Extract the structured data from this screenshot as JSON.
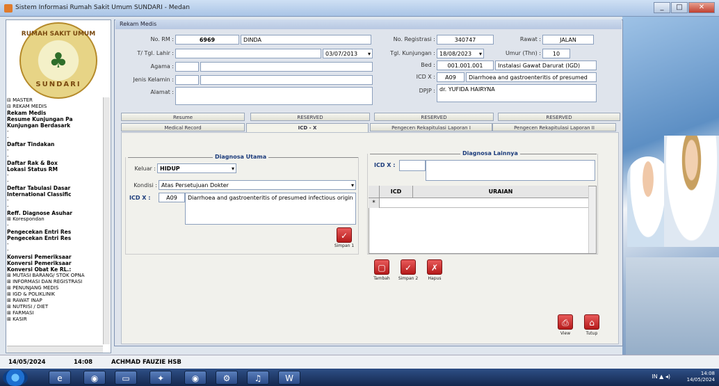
{
  "window": {
    "title": "Sistem Informasi Rumah Sakit Umum SUNDARI - Medan",
    "controls": [
      "_",
      "□",
      "✕"
    ]
  },
  "logo": {
    "top": "RUMAH SAKIT UMUM",
    "bottom": "SUNDARI"
  },
  "tree": [
    {
      "t": "⊟ MASTER",
      "c": ""
    },
    {
      "t": "⊟ REKAM MEDIS",
      "c": ""
    },
    {
      "t": "  Rekam Medis",
      "c": "b"
    },
    {
      "t": "  Resume Kunjungan Pa",
      "c": "b"
    },
    {
      "t": "  Kunjungan Berdasark",
      "c": "b"
    },
    {
      "t": "  -",
      "c": ""
    },
    {
      "t": "  -",
      "c": ""
    },
    {
      "t": "  Daftar Tindakan",
      "c": "b"
    },
    {
      "t": "  -",
      "c": ""
    },
    {
      "t": "  -",
      "c": ""
    },
    {
      "t": "  Daftar Rak & Box",
      "c": "b"
    },
    {
      "t": "  Lokasi Status RM",
      "c": "b"
    },
    {
      "t": "  -",
      "c": ""
    },
    {
      "t": "  -",
      "c": ""
    },
    {
      "t": "  Deftar Tabulasi Dasar",
      "c": "b"
    },
    {
      "t": "  International Classific",
      "c": "b"
    },
    {
      "t": "  -",
      "c": ""
    },
    {
      "t": "  -",
      "c": ""
    },
    {
      "t": "  Reff. Diagnose Asuhar",
      "c": "b"
    },
    {
      "t": " ⊞ Korespondan",
      "c": ""
    },
    {
      "t": "  -",
      "c": ""
    },
    {
      "t": "  Pengecekan Entri Res",
      "c": "b"
    },
    {
      "t": "  Pengecekan Entri Res",
      "c": "b"
    },
    {
      "t": "  -",
      "c": ""
    },
    {
      "t": "  -",
      "c": ""
    },
    {
      "t": "  Konversi Pemeriksaar",
      "c": "b"
    },
    {
      "t": "  Konversi Pemeriksaar",
      "c": "b"
    },
    {
      "t": "  Konversi Obat Ke RL.:",
      "c": "b"
    },
    {
      "t": "⊞ MUTASI BARANG/ STOK OPNA",
      "c": ""
    },
    {
      "t": "⊞ INFORMASI DAN REGISTRASI",
      "c": ""
    },
    {
      "t": "⊞ PENUNJANG MEDIS",
      "c": ""
    },
    {
      "t": "⊞ IGD & POLIKLINIK",
      "c": ""
    },
    {
      "t": "⊞ RAWAT INAP",
      "c": ""
    },
    {
      "t": "⊞ NUTRISI / DIET",
      "c": ""
    },
    {
      "t": "⊞ FARMASI",
      "c": ""
    },
    {
      "t": "⊞ KASIR",
      "c": ""
    }
  ],
  "form": {
    "header": "Rekam Medis",
    "no_rm_label": "No. RM :",
    "no_rm": "6969",
    "nama": "DINDA",
    "tgl_lahir_label": "T/ Tgl. Lahir :",
    "tgl_lahir": "03/07/2013",
    "agama_label": "Agama :",
    "jk_label": "Jenis Kelamin :",
    "alamat_label": "Alamat :",
    "no_reg_label": "No. Registrasi :",
    "no_reg": "340747",
    "rawat_label": "Rawat :",
    "rawat": "JALAN",
    "tgl_kunj_label": "Tgl. Kunjungan :",
    "tgl_kunj": "18/08/2023",
    "umur_label": "Umur (Thn) :",
    "umur": "10",
    "bed_label": "Bed :",
    "bed": "001.001.001",
    "bed_desc": "Instalasi Gawat Darurat (IGD)",
    "icd_label": "ICD X :",
    "icd": "A09",
    "icd_desc": "Diarrhoea and gastroenteritis of presumed",
    "dpjp_label": "DPJP :",
    "dpjp": "dr. YUFIDA HAIRYNA"
  },
  "tabs_top": [
    "Resume",
    "RESERVED",
    "RESERVED",
    "RESERVED"
  ],
  "tabs_bottom": [
    "Medical Record",
    "ICD - X",
    "Pengecen Rekapitulasi Laporan I",
    "Pengecen Rekapitulasi Laporan II"
  ],
  "diag_utama": {
    "title": "Diagnosa Utama",
    "keluar_label": "Keluar :",
    "keluar": "HIDUP",
    "kondisi_label": "Kondisi :",
    "kondisi": "Atas Persetujuan Dokter",
    "icd_label": "ICD X :",
    "icd": "A09",
    "desc": "Diarrhoea and gastroenteritis of presumed infectious origin",
    "simpan": "Simpan 1"
  },
  "diag_lain": {
    "title": "Diagnosa Lainnya",
    "icd_label": "ICD X :",
    "col_icd": "ICD",
    "col_uraian": "URAIAN",
    "row_marker": "*",
    "btn_tambah": "Tambah",
    "btn_simpan": "Simpan 2",
    "btn_hapus": "Hapus"
  },
  "bottom_btns": {
    "view": "View",
    "tutup": "Tutup"
  },
  "status": {
    "date": "14/05/2024",
    "time": "14:08",
    "user": "ACHMAD FAUZIE HSB"
  },
  "taskbar": {
    "clock_time": "14:08",
    "clock_date": "14/05/2024",
    "tray": "IN ▲ ◂)"
  }
}
